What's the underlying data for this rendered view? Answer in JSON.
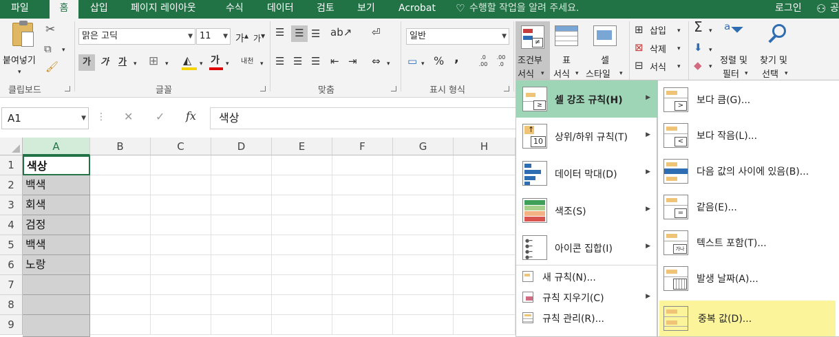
{
  "tabs": [
    "파일",
    "홈",
    "삽입",
    "페이지 레이아웃",
    "수식",
    "데이터",
    "검토",
    "보기",
    "Acrobat"
  ],
  "tell_me": "수행할 작업을 알려 주세요.",
  "login": "로그인",
  "share": "공",
  "ribbon": {
    "clipboard": {
      "paste": "붙여넣기",
      "group": "클립보드"
    },
    "font": {
      "name": "맑은 고딕",
      "size": "11",
      "bold": "가",
      "italic": "가",
      "underline": "가",
      "color_glyph": "가",
      "phonetic": "내천",
      "group": "글꼴"
    },
    "align": {
      "group": "맞춤"
    },
    "number": {
      "format": "일반",
      "percent": "%",
      "comma": ",",
      "inc": ".0 .00",
      "dec": ".00 .0",
      "group": "표시 형식"
    },
    "styles": {
      "cond_line1": "조건부",
      "cond_line2": "서식",
      "table_line1": "표",
      "table_line2": "서식",
      "cell_line1": "셀",
      "cell_line2": "스타일"
    },
    "cells": {
      "insert": "삽입",
      "delete": "삭제",
      "format": "서식"
    },
    "editing": {
      "sum": "Σ",
      "sort_line1": "정렬 및",
      "sort_line2": "필터",
      "find_line1": "찾기 및",
      "find_line2": "선택"
    }
  },
  "formula_bar": {
    "name_box": "A1",
    "cancel": "✕",
    "enter": "✓",
    "fx": "fx",
    "value": "색상"
  },
  "columns": [
    "A",
    "B",
    "C",
    "D",
    "E",
    "F",
    "G",
    "H"
  ],
  "rows": [
    "1",
    "2",
    "3",
    "4",
    "5",
    "6",
    "7",
    "8",
    "9"
  ],
  "cells_a": [
    "색상",
    "백색",
    "회색",
    "검정",
    "백색",
    "노랑",
    "",
    "",
    ""
  ],
  "cond_menu": {
    "items": [
      "셀 강조 규칙(H)",
      "상위/하위 규칙(T)",
      "데이터 막대(D)",
      "색조(S)",
      "아이콘 집합(I)"
    ],
    "extra": [
      "새 규칙(N)...",
      "규칙 지우기(C)",
      "규칙 관리(R)..."
    ]
  },
  "submenu": {
    "items": [
      "보다 큼(G)...",
      "보다 작음(L)...",
      "다음 값의 사이에 있음(B)...",
      "같음(E)...",
      "텍스트 포함(T)...",
      "발생 날짜(A)...",
      "중복 값(D)..."
    ]
  },
  "colors": {
    "excel_green": "#217346",
    "menu_highlight": "#9fd5b7",
    "submenu_highlight": "#fcf49b"
  }
}
